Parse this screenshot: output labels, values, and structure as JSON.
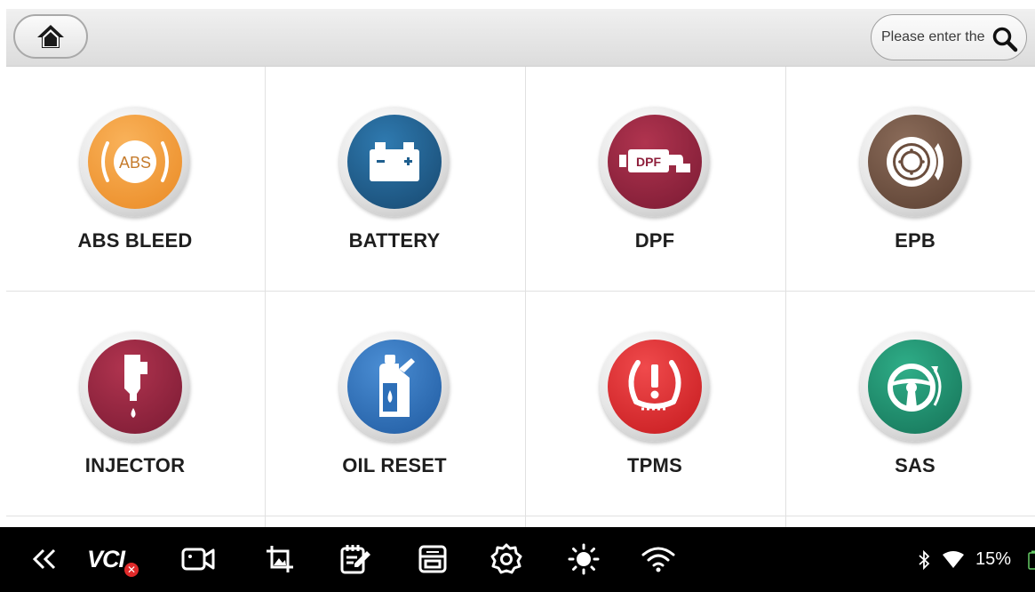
{
  "search": {
    "placeholder": "Please enter the"
  },
  "tiles": [
    {
      "label": "ABS BLEED",
      "icon": "abs-icon",
      "color": "#f0922e"
    },
    {
      "label": "BATTERY",
      "icon": "battery-icon",
      "color": "#1f5f8f"
    },
    {
      "label": "DPF",
      "icon": "dpf-icon",
      "color": "#8e1f3b"
    },
    {
      "label": "EPB",
      "icon": "epb-icon",
      "color": "#6b4e3e"
    },
    {
      "label": "INJECTOR",
      "icon": "injector-icon",
      "color": "#8e1f3b"
    },
    {
      "label": "OIL RESET",
      "icon": "oil-reset-icon",
      "color": "#2d6fb8"
    },
    {
      "label": "TPMS",
      "icon": "tpms-icon",
      "color": "#e0282c"
    },
    {
      "label": "SAS",
      "icon": "sas-icon",
      "color": "#1f8f6c"
    }
  ],
  "navbar": {
    "vci_label": "VCI",
    "icons": [
      "back-double-chevron-icon",
      "vci-icon",
      "video-record-icon",
      "screenshot-crop-icon",
      "notes-edit-icon",
      "print-icon",
      "settings-gear-icon",
      "brightness-icon",
      "wifi-icon"
    ]
  },
  "status": {
    "battery_percent": "15%",
    "icons": [
      "bluetooth-icon",
      "wifi-signal-icon",
      "battery-icon"
    ]
  },
  "colors": {
    "topbar": "#e4e4e4",
    "navbar": "#000000",
    "label": "#1e1e1e"
  }
}
